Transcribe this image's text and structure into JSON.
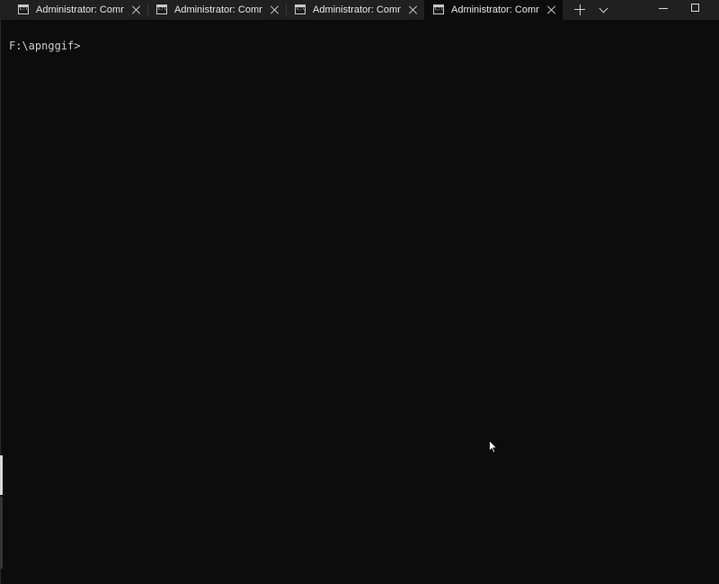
{
  "tabs": [
    {
      "title": "Administrator: Command Prompt",
      "icon": "cmd-icon",
      "active": false
    },
    {
      "title": "Administrator: Command Prompt",
      "icon": "cmd-icon",
      "active": false
    },
    {
      "title": "Administrator: Command Prompt",
      "icon": "cmd-icon",
      "active": false
    },
    {
      "title": "Administrator: Command Prompt",
      "icon": "cmd-icon",
      "active": true
    }
  ],
  "terminal": {
    "prompt": "F:\\apnggif>"
  },
  "colors": {
    "tabbar_bg": "#202020",
    "active_tab_bg": "#0c0c0c",
    "terminal_bg": "#0c0c0c",
    "terminal_fg": "#cccccc"
  }
}
